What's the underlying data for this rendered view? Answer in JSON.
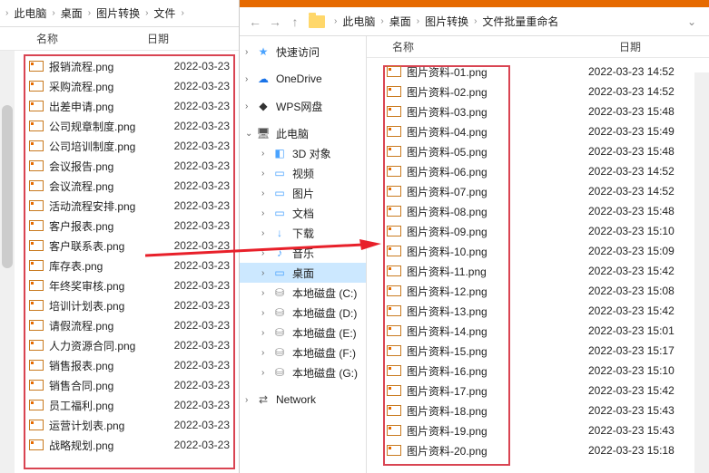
{
  "left": {
    "breadcrumb": [
      "此电脑",
      "桌面",
      "图片转换",
      "文件"
    ],
    "columns": {
      "name": "名称",
      "date": "日期"
    },
    "files": [
      {
        "name": "报销流程.png",
        "date": "2022-03-23"
      },
      {
        "name": "采购流程.png",
        "date": "2022-03-23"
      },
      {
        "name": "出差申请.png",
        "date": "2022-03-23"
      },
      {
        "name": "公司规章制度.png",
        "date": "2022-03-23"
      },
      {
        "name": "公司培训制度.png",
        "date": "2022-03-23"
      },
      {
        "name": "会议报告.png",
        "date": "2022-03-23"
      },
      {
        "name": "会议流程.png",
        "date": "2022-03-23"
      },
      {
        "name": "活动流程安排.png",
        "date": "2022-03-23"
      },
      {
        "name": "客户报表.png",
        "date": "2022-03-23"
      },
      {
        "name": "客户联系表.png",
        "date": "2022-03-23"
      },
      {
        "name": "库存表.png",
        "date": "2022-03-23"
      },
      {
        "name": "年终奖审核.png",
        "date": "2022-03-23"
      },
      {
        "name": "培训计划表.png",
        "date": "2022-03-23"
      },
      {
        "name": "请假流程.png",
        "date": "2022-03-23"
      },
      {
        "name": "人力资源合同.png",
        "date": "2022-03-23"
      },
      {
        "name": "销售报表.png",
        "date": "2022-03-23"
      },
      {
        "name": "销售合同.png",
        "date": "2022-03-23"
      },
      {
        "name": "员工福利.png",
        "date": "2022-03-23"
      },
      {
        "name": "运营计划表.png",
        "date": "2022-03-23"
      },
      {
        "name": "战略规划.png",
        "date": "2022-03-23"
      }
    ]
  },
  "right": {
    "breadcrumb": [
      "此电脑",
      "桌面",
      "图片转换",
      "文件批量重命名"
    ],
    "columns": {
      "name": "名称",
      "date": "日期"
    },
    "tree": {
      "quick_access": "快速访问",
      "onedrive": "OneDrive",
      "wps": "WPS网盘",
      "this_pc": "此电脑",
      "objects_3d": "3D 对象",
      "videos": "视频",
      "pictures": "图片",
      "documents": "文档",
      "downloads": "下载",
      "music": "音乐",
      "desktop": "桌面",
      "drive_c": "本地磁盘 (C:)",
      "drive_d": "本地磁盘 (D:)",
      "drive_e": "本地磁盘 (E:)",
      "drive_f": "本地磁盘 (F:)",
      "drive_g": "本地磁盘 (G:)",
      "network": "Network"
    },
    "files": [
      {
        "name": "图片资料-01.png",
        "date": "2022-03-23 14:52"
      },
      {
        "name": "图片资料-02.png",
        "date": "2022-03-23 14:52"
      },
      {
        "name": "图片资料-03.png",
        "date": "2022-03-23 15:48"
      },
      {
        "name": "图片资料-04.png",
        "date": "2022-03-23 15:49"
      },
      {
        "name": "图片资料-05.png",
        "date": "2022-03-23 15:48"
      },
      {
        "name": "图片资料-06.png",
        "date": "2022-03-23 14:52"
      },
      {
        "name": "图片资料-07.png",
        "date": "2022-03-23 14:52"
      },
      {
        "name": "图片资料-08.png",
        "date": "2022-03-23 15:48"
      },
      {
        "name": "图片资料-09.png",
        "date": "2022-03-23 15:10"
      },
      {
        "name": "图片资料-10.png",
        "date": "2022-03-23 15:09"
      },
      {
        "name": "图片资料-11.png",
        "date": "2022-03-23 15:42"
      },
      {
        "name": "图片资料-12.png",
        "date": "2022-03-23 15:08"
      },
      {
        "name": "图片资料-13.png",
        "date": "2022-03-23 15:42"
      },
      {
        "name": "图片资料-14.png",
        "date": "2022-03-23 15:01"
      },
      {
        "name": "图片资料-15.png",
        "date": "2022-03-23 15:17"
      },
      {
        "name": "图片资料-16.png",
        "date": "2022-03-23 15:10"
      },
      {
        "name": "图片资料-17.png",
        "date": "2022-03-23 15:42"
      },
      {
        "name": "图片资料-18.png",
        "date": "2022-03-23 15:43"
      },
      {
        "name": "图片资料-19.png",
        "date": "2022-03-23 15:43"
      },
      {
        "name": "图片资料-20.png",
        "date": "2022-03-23 15:18"
      }
    ]
  }
}
